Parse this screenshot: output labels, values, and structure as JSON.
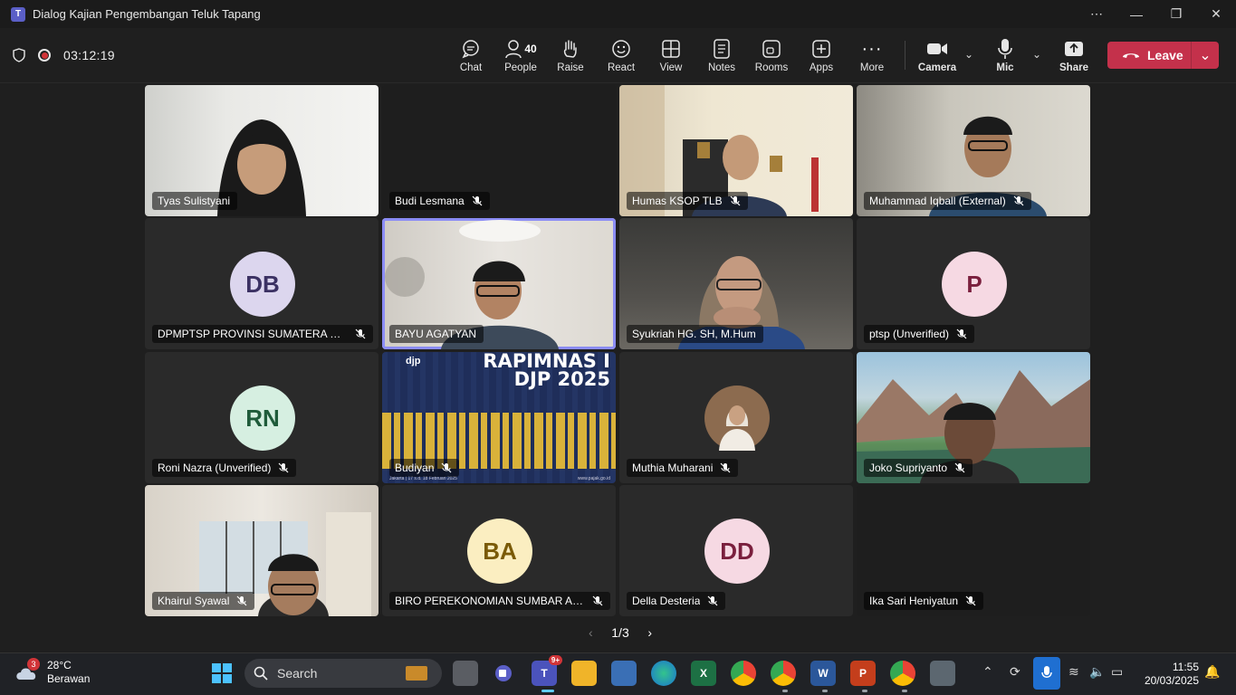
{
  "window": {
    "title": "Dialog Kajian Pengembangan Teluk Tapang"
  },
  "meeting": {
    "timer": "03:12:19",
    "people_count": "40"
  },
  "toolbar": {
    "chat": "Chat",
    "people": "People",
    "raise": "Raise",
    "react": "React",
    "view": "View",
    "notes": "Notes",
    "rooms": "Rooms",
    "apps": "Apps",
    "more": "More",
    "camera": "Camera",
    "mic": "Mic",
    "share": "Share",
    "leave": "Leave"
  },
  "participants": [
    {
      "name": "Tyas Sulistyani",
      "muted": false,
      "type": "video"
    },
    {
      "name": "Budi Lesmana",
      "muted": true,
      "type": "dark"
    },
    {
      "name": "Humas KSOP TLB",
      "muted": true,
      "type": "video"
    },
    {
      "name": "Muhammad Iqball (External)",
      "muted": true,
      "type": "video"
    },
    {
      "name": "DPMPTSP PROVINSI SUMATERA BAR...",
      "muted": true,
      "type": "avatar",
      "initials": "DB"
    },
    {
      "name": "BAYU AGATYAN",
      "muted": false,
      "type": "video",
      "active": true
    },
    {
      "name": "Syukriah HG. SH, M.Hum",
      "muted": false,
      "type": "video"
    },
    {
      "name": "ptsp (Unverified)",
      "muted": true,
      "type": "avatar",
      "initials": "P"
    },
    {
      "name": "Roni Nazra (Unverified)",
      "muted": true,
      "type": "avatar",
      "initials": "RN"
    },
    {
      "name": "Budiyan",
      "muted": true,
      "type": "slide"
    },
    {
      "name": "Muthia Muharani",
      "muted": true,
      "type": "photo"
    },
    {
      "name": "Joko Supriyanto",
      "muted": true,
      "type": "video"
    },
    {
      "name": "Khairul Syawal",
      "muted": true,
      "type": "video"
    },
    {
      "name": "BIRO PEREKONOMIAN SUMBAR AZ...",
      "muted": true,
      "type": "avatar",
      "initials": "BA"
    },
    {
      "name": "Della Desteria",
      "muted": true,
      "type": "avatar",
      "initials": "DD"
    },
    {
      "name": "Ika Sari Heniyatun",
      "muted": true,
      "type": "dark"
    }
  ],
  "slide": {
    "logo": "djp",
    "line1": "RAPIMNAS I",
    "line2": "DJP 2025",
    "footer": "Jakarta | 17 s.d. 18 Februari 2025",
    "site": "www.pajak.go.id"
  },
  "pager": {
    "label": "1/3"
  },
  "taskbar": {
    "weather_badge": "3",
    "temp": "28°C",
    "condition": "Berawan",
    "search_placeholder": "Search",
    "teams_badge": "9+",
    "time": "11:55",
    "date": "20/03/2025"
  },
  "colors": {
    "leave": "#c4314b",
    "active_border": "#8b8cf5",
    "brand": "#5b5fc7"
  }
}
